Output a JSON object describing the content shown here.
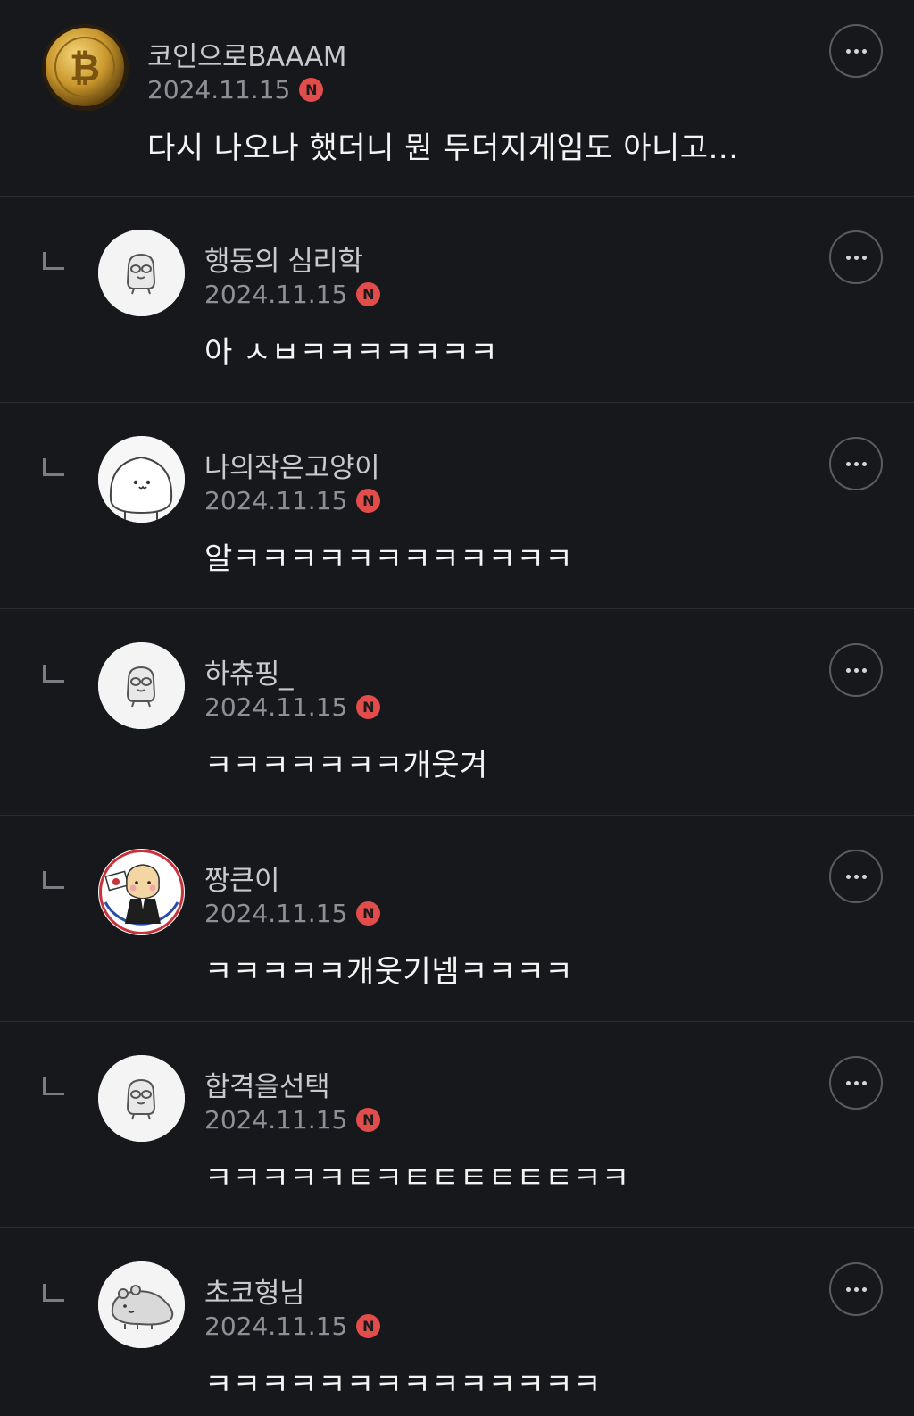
{
  "comments": [
    {
      "author": "코인으로BAAAM",
      "date": "2024.11.15",
      "badge": "N",
      "text": "다시 나오나 했더니 뭔 두더지게임도 아니고...",
      "avatar_icon": "bitcoin-coin-icon",
      "is_reply": false
    },
    {
      "author": "행동의 심리학",
      "date": "2024.11.15",
      "badge": "N",
      "text": "아 ㅅㅂㅋㅋㅋㅋㅋㅋㅋ",
      "avatar_icon": "default-character-icon",
      "is_reply": true
    },
    {
      "author": "나의작은고양이",
      "date": "2024.11.15",
      "badge": "N",
      "text": "알ㅋㅋㅋㅋㅋㅋㅋㅋㅋㅋㅋㅋ",
      "avatar_icon": "white-blob-character-icon",
      "is_reply": true
    },
    {
      "author": "하츄핑_",
      "date": "2024.11.15",
      "badge": "N",
      "text": "ㅋㅋㅋㅋㅋㅋㅋ개웃겨",
      "avatar_icon": "default-character-icon",
      "is_reply": true
    },
    {
      "author": "짱큰이",
      "date": "2024.11.15",
      "badge": "N",
      "text": "ㅋㅋㅋㅋㅋ개웃기넴ㅋㅋㅋㅋ",
      "avatar_icon": "hamster-flag-character-icon",
      "is_reply": true
    },
    {
      "author": "합격을선택",
      "date": "2024.11.15",
      "badge": "N",
      "text": "ㅋㅋㅋㅋㅋㅌㅋㅌㅌㅌㅌㅌㅌㅋㅋ",
      "avatar_icon": "default-character-icon",
      "is_reply": true
    },
    {
      "author": "초코형님",
      "date": "2024.11.15",
      "badge": "N",
      "text": "ㅋㅋㅋㅋㅋㅋㅋㅋㅋㅋㅋㅋㅋㅋ",
      "avatar_icon": "lying-creature-character-icon",
      "is_reply": true
    }
  ],
  "colors": {
    "background": "#17181c",
    "badge": "#e24c4b",
    "divider": "#2b2c31"
  }
}
